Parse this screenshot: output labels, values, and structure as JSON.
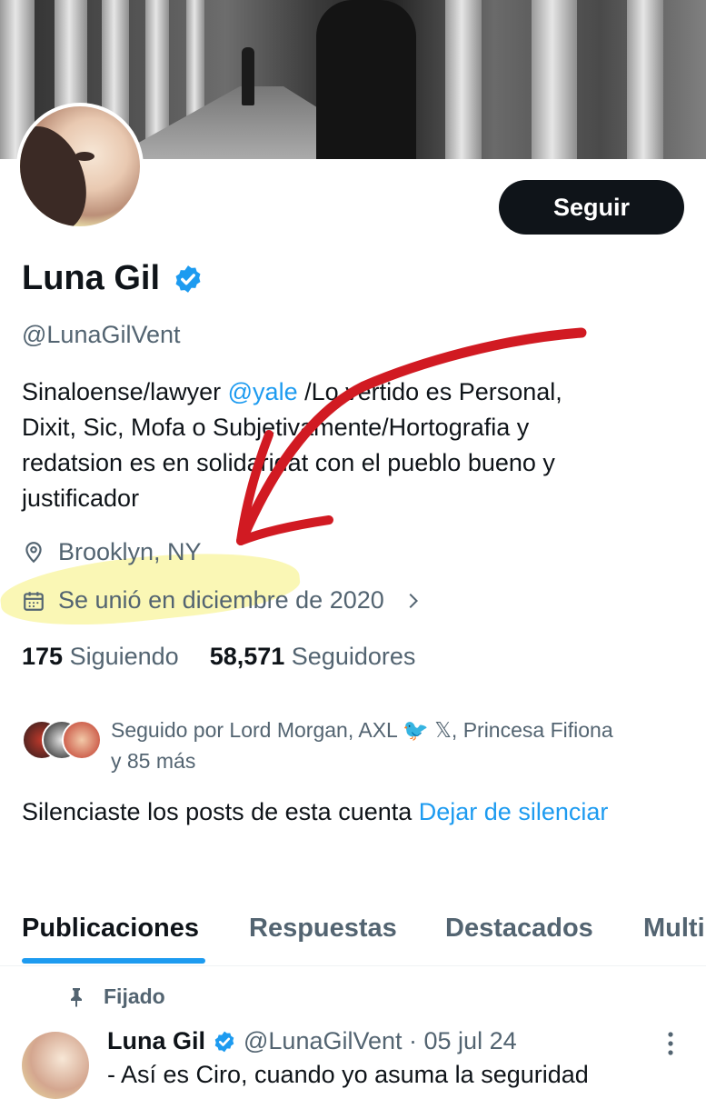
{
  "profile": {
    "name": "Luna Gil",
    "handle": "@LunaGilVent",
    "follow_label": "Seguir",
    "bio_prefix": "Sinaloense/lawyer ",
    "bio_link": "@yale",
    "bio_line1_rest": " /Lo vertido es Personal,",
    "bio_line2": "Dixit, Sic, Mofa o Subjetivamente/Hortografia y",
    "bio_line3": "redatsion es en solidaridat con el pueblo bueno y",
    "bio_line4": "justificador",
    "location": "Brooklyn, NY",
    "joined": "Se unió en diciembre de 2020",
    "following_count": "175",
    "following_label": "Siguiendo",
    "followers_count": "58,571",
    "followers_label": "Seguidores",
    "followed_by_line1": "Seguido por Lord Morgan, AXL 🐦 𝕏, Princesa Fifiona",
    "followed_by_line2": "y 85 más",
    "muted_text": "Silenciaste los posts de esta cuenta ",
    "unmute_link": "Dejar de silenciar"
  },
  "tabs": [
    {
      "label": "Publicaciones"
    },
    {
      "label": "Respuestas"
    },
    {
      "label": "Destacados"
    },
    {
      "label": "Multi"
    }
  ],
  "post": {
    "pinned_label": "Fijado",
    "author": "Luna Gil",
    "meta": "@LunaGilVent · 05 jul 24",
    "text": "- Así es Ciro, cuando yo asuma la seguridad"
  },
  "colors": {
    "accent": "#1d9bf0",
    "text_primary": "#0f1419",
    "text_secondary": "#536471",
    "annotation_arrow": "#d11a22",
    "annotation_highlight": "#f5f078"
  }
}
